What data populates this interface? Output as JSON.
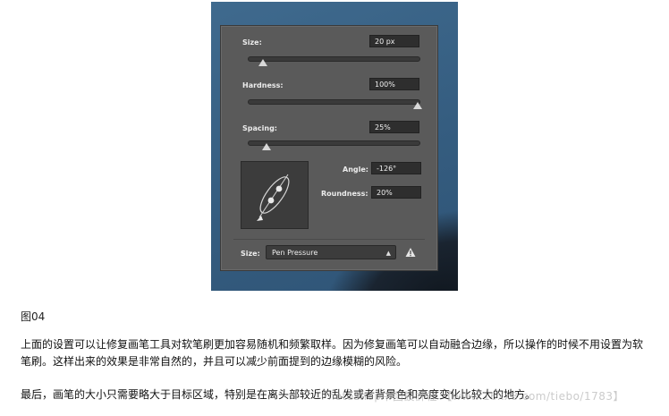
{
  "brush_panel": {
    "size_label": "Size:",
    "size_value": "20 px",
    "size_slider_fraction": 0.09,
    "hardness_label": "Hardness:",
    "hardness_value": "100%",
    "hardness_slider_fraction": 1.0,
    "spacing_label": "Spacing:",
    "spacing_value": "25%",
    "spacing_slider_fraction": 0.11,
    "angle_label": "Angle:",
    "angle_value": "-126°",
    "roundness_label": "Roundness:",
    "roundness_value": "20%",
    "pressure_label": "Size:",
    "pressure_option": "Pen Pressure",
    "warning_icon": "warning-triangle-icon"
  },
  "article": {
    "caption": "图04",
    "paragraph1": "上面的设置可以让修复画笔工具对软笔刷更加容易随机和频繁取样。因为修复画笔可以自动融合边缘，所以操作的时候不用设置为软笔刷。这样出来的效果是非常自然的，并且可以减少前面提到的边缘模糊的风险。",
    "paragraph2": "最后，画笔的大小只需要略大于目标区域，特别是在离头部较近的乱发或者背景色和亮度变化比较大的地方。",
    "watermark": "Photoshop中國設計社 【www.16xx8.com/tiebo/1783】"
  }
}
